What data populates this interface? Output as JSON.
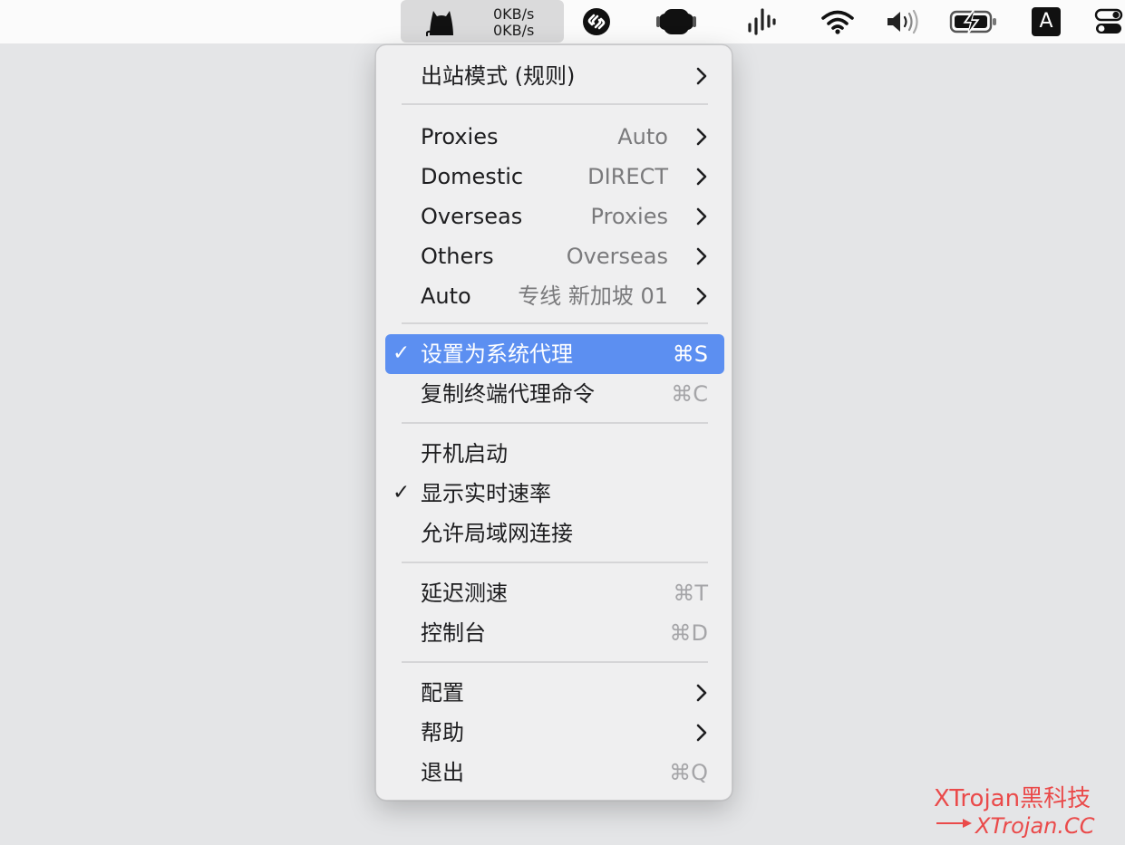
{
  "menubar": {
    "speed": {
      "up": "0KB/s",
      "down": "0KB/s"
    },
    "keyboard_input_label": "A",
    "icons": [
      "clash-cat-icon",
      "shazam-icon",
      "hardware-device-icon",
      "audio-waveform-icon",
      "wifi-icon",
      "volume-icon",
      "battery-charging-icon",
      "input-source-icon",
      "control-center-icon"
    ]
  },
  "menu": {
    "outbound_mode": {
      "label": "出站模式 (规则)"
    },
    "proxy_groups": [
      {
        "label": "Proxies",
        "value": "Auto"
      },
      {
        "label": "Domestic",
        "value": "DIRECT"
      },
      {
        "label": "Overseas",
        "value": "Proxies"
      },
      {
        "label": "Others",
        "value": "Overseas"
      },
      {
        "label": "Auto",
        "value": "专线 新加坡 01"
      }
    ],
    "system_proxy": {
      "label": "设置为系统代理",
      "shortcut": "⌘S",
      "checked": true,
      "check": "✓"
    },
    "copy_terminal": {
      "label": "复制终端代理命令",
      "shortcut": "⌘C"
    },
    "launch_at_login": {
      "label": "开机启动"
    },
    "show_speed": {
      "label": "显示实时速率",
      "checked": true,
      "check": "✓"
    },
    "allow_lan": {
      "label": "允许局域网连接"
    },
    "benchmark": {
      "label": "延迟测速",
      "shortcut": "⌘T"
    },
    "dashboard": {
      "label": "控制台",
      "shortcut": "⌘D"
    },
    "config": {
      "label": "配置"
    },
    "help": {
      "label": "帮助"
    },
    "quit": {
      "label": "退出",
      "shortcut": "⌘Q"
    }
  },
  "watermark": {
    "line1": "XTrojan黑科技",
    "line2": "XTrojan.CC"
  },
  "colors": {
    "highlight": "#5c8ff1",
    "watermark": "#ea4a4a",
    "menu_bg": "#efeff0",
    "desktop": "#e4e5e7"
  }
}
